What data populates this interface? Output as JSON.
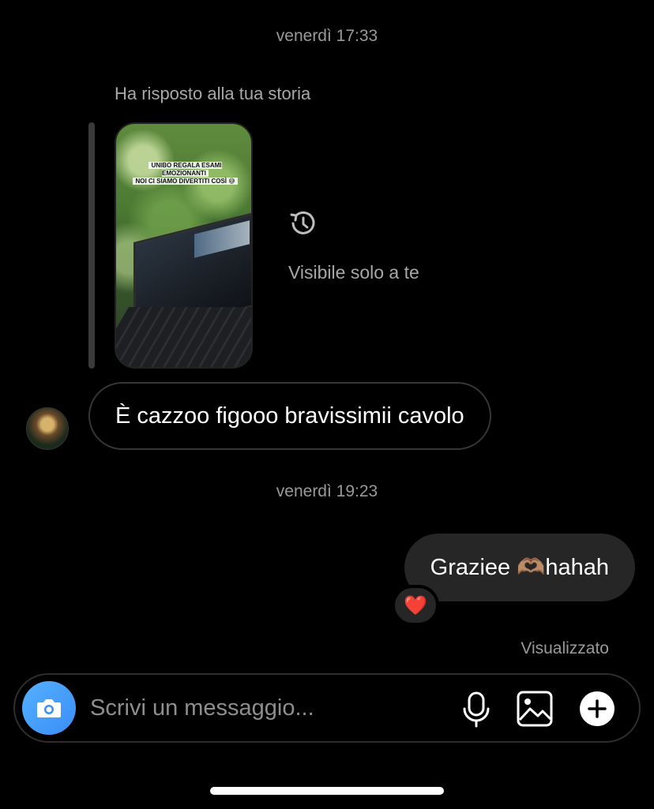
{
  "timestamps": [
    "venerdì 17:33",
    "venerdì 19:23"
  ],
  "story_reply": {
    "label": "Ha risposto alla tua storia",
    "story_caption_line1": "UNIBO REGALA ESAMI EMOZIONANTI",
    "story_caption_line2": "NOI CI SIAMO DIVERTITI COSÌ 😅",
    "visibility_icon": "history-icon",
    "visibility_text": "Visibile solo a te"
  },
  "messages": {
    "incoming": "È cazzoo figooo bravissimii cavolo",
    "outgoing": "Graziee 🫶🏽hahah",
    "reaction": "❤️"
  },
  "status": {
    "seen": "Visualizzato"
  },
  "composer": {
    "placeholder": "Scrivi un messaggio...",
    "icons": [
      "camera-icon",
      "microphone-icon",
      "gallery-icon",
      "plus-icon"
    ],
    "camera_color": "#3a8ef6"
  }
}
